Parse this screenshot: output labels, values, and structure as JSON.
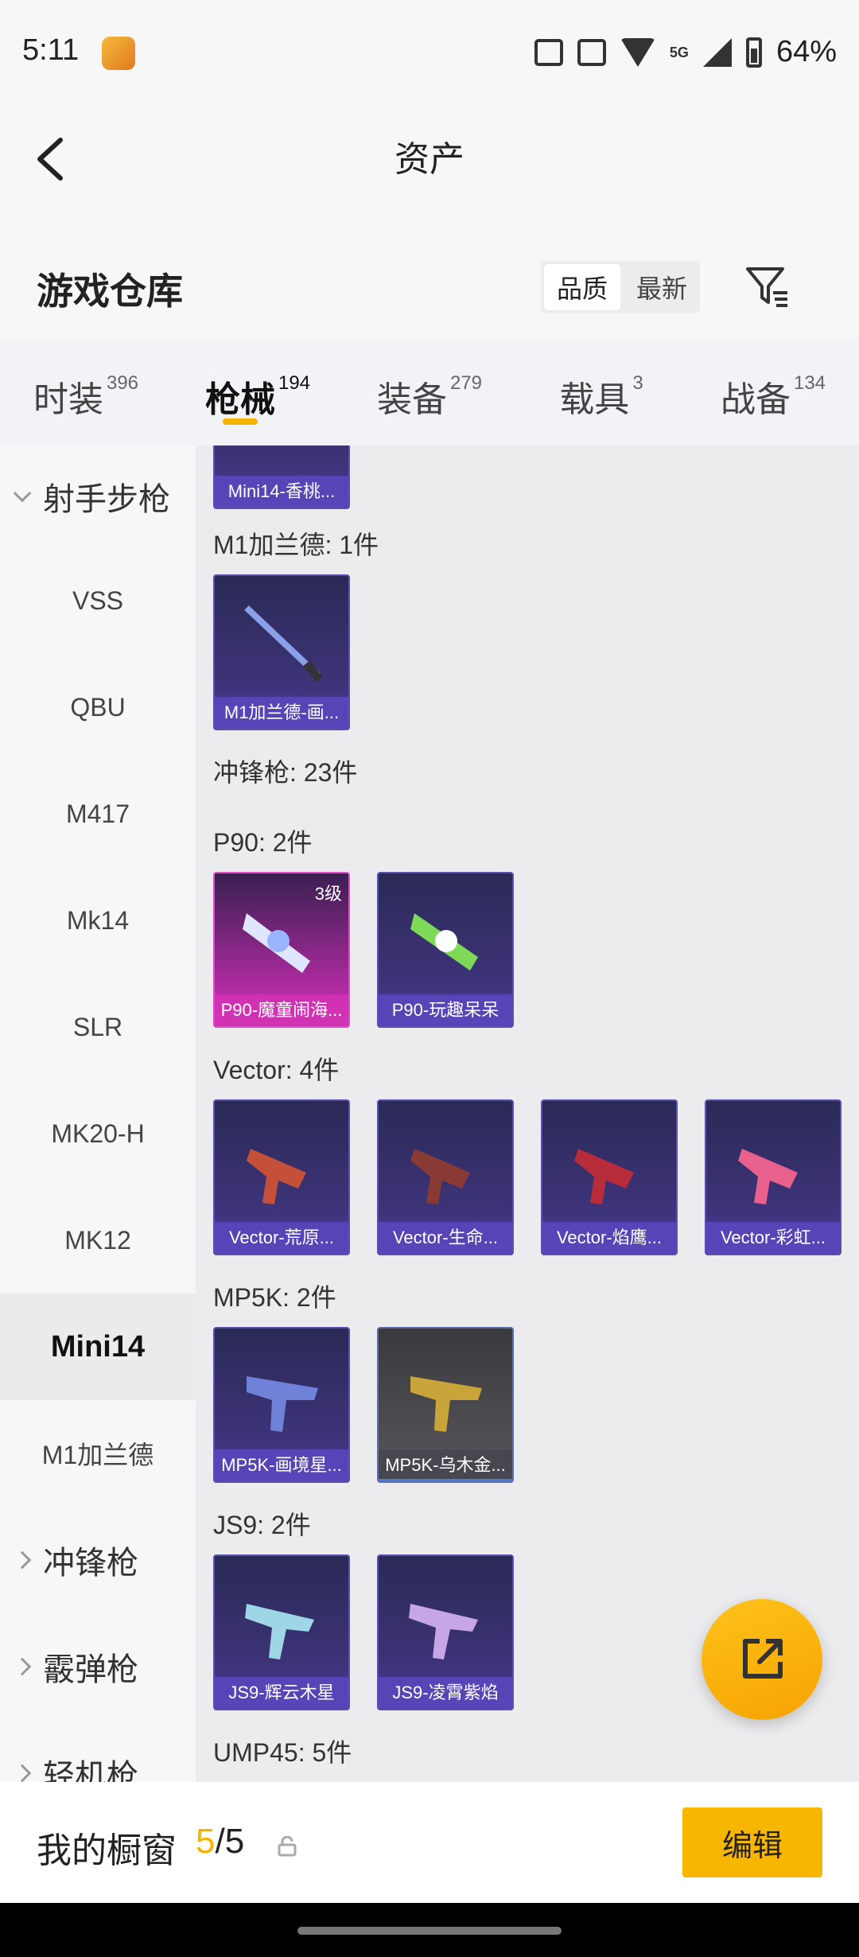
{
  "status_bar": {
    "time": "5:11",
    "battery": "64%",
    "network": "5G"
  },
  "header": {
    "title": "资产"
  },
  "warehouse": {
    "title": "游戏仓库",
    "sort_options": [
      "品质",
      "最新"
    ]
  },
  "tabs": [
    {
      "label": "时装",
      "count": "396"
    },
    {
      "label": "枪械",
      "count": "194"
    },
    {
      "label": "装备",
      "count": "279"
    },
    {
      "label": "载具",
      "count": "3"
    },
    {
      "label": "战备",
      "count": "134"
    }
  ],
  "sidebar": {
    "items": [
      {
        "label": "射手步枪"
      },
      {
        "label": "VSS"
      },
      {
        "label": "QBU"
      },
      {
        "label": "M417"
      },
      {
        "label": "Mk14"
      },
      {
        "label": "SLR"
      },
      {
        "label": "MK20-H"
      },
      {
        "label": "MK12"
      },
      {
        "label": "Mini14"
      },
      {
        "label": "M1加兰德"
      },
      {
        "label": "冲锋枪"
      },
      {
        "label": "霰弹枪"
      },
      {
        "label": "轻机枪"
      }
    ]
  },
  "content": {
    "top_card": {
      "label": "Mini14-香桃..."
    },
    "sections": [
      {
        "title": "M1加兰德: 1件",
        "cards": [
          {
            "label": "M1加兰德-画..."
          }
        ]
      },
      {
        "title": "冲锋枪: 23件"
      },
      {
        "title": "P90: 2件",
        "cards": [
          {
            "label": "P90-魔童闹海...",
            "level": "3级"
          },
          {
            "label": "P90-玩趣呆呆"
          }
        ]
      },
      {
        "title": "Vector: 4件",
        "cards": [
          {
            "label": "Vector-荒原..."
          },
          {
            "label": "Vector-生命..."
          },
          {
            "label": "Vector-焰鹰..."
          },
          {
            "label": "Vector-彩虹..."
          }
        ]
      },
      {
        "title": "MP5K: 2件",
        "cards": [
          {
            "label": "MP5K-画境星..."
          },
          {
            "label": "MP5K-乌木金..."
          }
        ]
      },
      {
        "title": "JS9: 2件",
        "cards": [
          {
            "label": "JS9-辉云木星"
          },
          {
            "label": "JS9-凌霄紫焰"
          }
        ]
      },
      {
        "title": "UMP45: 5件"
      }
    ]
  },
  "bottom_bar": {
    "showcase_label": "我的橱窗",
    "showcase_current": "5",
    "showcase_total": "/5",
    "edit_label": "编辑"
  },
  "colors": {
    "accent": "#f7b600",
    "card_purple": "#4b3f9a",
    "card_pink": "#d23ab7"
  }
}
